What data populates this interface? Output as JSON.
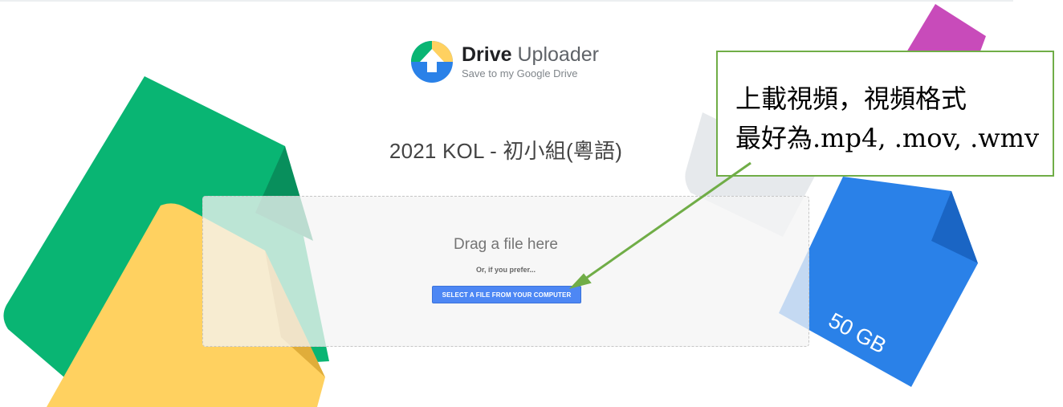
{
  "app": {
    "brand_bold": "Drive",
    "brand_rest": " Uploader",
    "tagline": "Save to my Google Drive"
  },
  "main": {
    "title": "2021 KOL - 初小組(粵語)",
    "dropzone": {
      "drag_text": "Drag a file here",
      "prefer_text": "Or, if you prefer...",
      "select_button_label": "SELECT A FILE FROM YOUR COMPUTER"
    }
  },
  "decoration": {
    "storage_label": "50 GB"
  },
  "annotation": {
    "line1": "上載視頻，視頻格式",
    "line2": "最好為.mp4, .mov, .wmv"
  },
  "colors": {
    "green": "#09b573",
    "yellow": "#ffd160",
    "blue": "#2a81e8",
    "magenta": "#c84bba",
    "callout_border": "#70ad47",
    "button": "#4d87f4"
  },
  "icons": {
    "logo": "drive-uploader-logo-icon",
    "upload_arrow": "upload-arrow-icon"
  }
}
